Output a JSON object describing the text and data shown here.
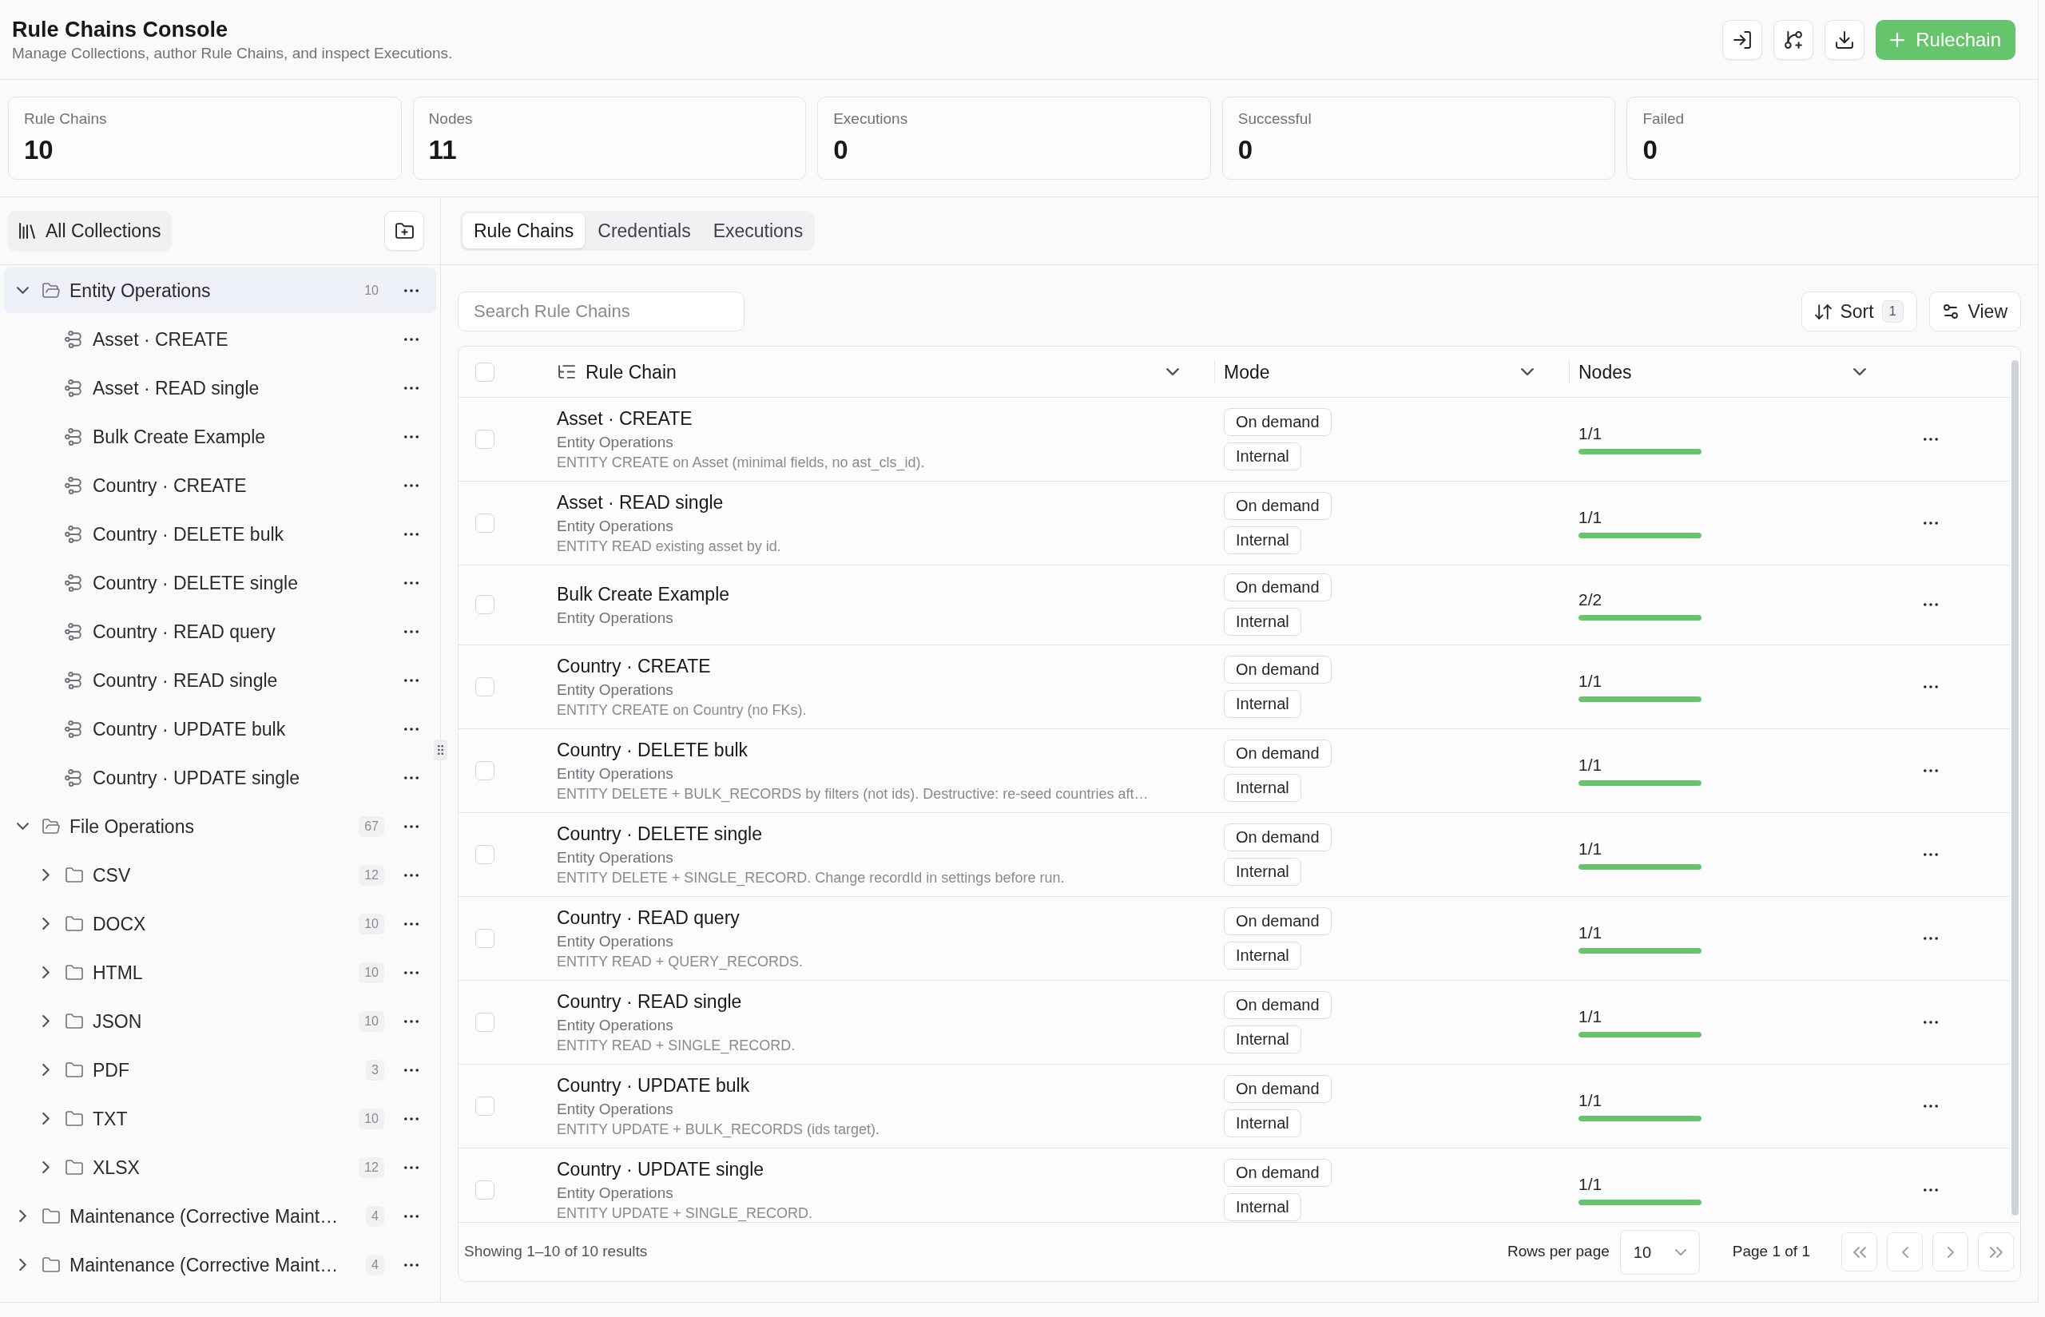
{
  "header": {
    "title": "Rule Chains Console",
    "subtitle": "Manage Collections, author Rule Chains, and inspect Executions.",
    "primary_button": "Rulechain"
  },
  "stats": [
    {
      "label": "Rule Chains",
      "value": "10"
    },
    {
      "label": "Nodes",
      "value": "11"
    },
    {
      "label": "Executions",
      "value": "0"
    },
    {
      "label": "Successful",
      "value": "0"
    },
    {
      "label": "Failed",
      "value": "0"
    }
  ],
  "sidebar": {
    "all_collections": "All Collections",
    "tree": [
      {
        "kind": "folder",
        "label": "Entity Operations",
        "count": "10",
        "expanded": true,
        "selected": true,
        "children": [
          {
            "kind": "rulechain",
            "label": "Asset · CREATE",
            "selected": false
          },
          {
            "kind": "rulechain",
            "label": "Asset · READ single",
            "selected": false
          },
          {
            "kind": "rulechain",
            "label": "Bulk Create Example",
            "selected": false
          },
          {
            "kind": "rulechain",
            "label": "Country · CREATE",
            "selected": false
          },
          {
            "kind": "rulechain",
            "label": "Country · DELETE bulk",
            "selected": false
          },
          {
            "kind": "rulechain",
            "label": "Country · DELETE single",
            "selected": false
          },
          {
            "kind": "rulechain",
            "label": "Country · READ query",
            "selected": false
          },
          {
            "kind": "rulechain",
            "label": "Country · READ single",
            "selected": false
          },
          {
            "kind": "rulechain",
            "label": "Country · UPDATE bulk",
            "selected": false
          },
          {
            "kind": "rulechain",
            "label": "Country · UPDATE single",
            "selected": false
          }
        ]
      },
      {
        "kind": "folder",
        "label": "File Operations",
        "count": "67",
        "expanded": true,
        "selected": false,
        "children": [
          {
            "kind": "folder",
            "label": "CSV",
            "count": "12",
            "expanded": false,
            "selected": false
          },
          {
            "kind": "folder",
            "label": "DOCX",
            "count": "10",
            "expanded": false,
            "selected": false
          },
          {
            "kind": "folder",
            "label": "HTML",
            "count": "10",
            "expanded": false,
            "selected": false
          },
          {
            "kind": "folder",
            "label": "JSON",
            "count": "10",
            "expanded": false,
            "selected": false
          },
          {
            "kind": "folder",
            "label": "PDF",
            "count": "3",
            "expanded": false,
            "selected": false
          },
          {
            "kind": "folder",
            "label": "TXT",
            "count": "10",
            "expanded": false,
            "selected": false
          },
          {
            "kind": "folder",
            "label": "XLSX",
            "count": "12",
            "expanded": false,
            "selected": false
          }
        ]
      },
      {
        "kind": "folder",
        "label": "Maintenance (Corrective Maint…",
        "count": "4",
        "expanded": false,
        "selected": false
      },
      {
        "kind": "folder",
        "label": "Maintenance (Corrective Maint…",
        "count": "4",
        "expanded": false,
        "selected": false
      }
    ]
  },
  "tabs": [
    {
      "label": "Rule Chains",
      "selected": true
    },
    {
      "label": "Credentials",
      "selected": false
    },
    {
      "label": "Executions",
      "selected": false
    }
  ],
  "toolbar": {
    "search": {
      "placeholder": "Search Rule Chains"
    },
    "sort": {
      "label": "Sort",
      "count": "1"
    },
    "view": {
      "label": "View"
    }
  },
  "table": {
    "select_all": {
      "checked": false
    },
    "columns": [
      {
        "label": "Rule Chain"
      },
      {
        "label": "Mode"
      },
      {
        "label": "Nodes"
      }
    ],
    "rows": [
      {
        "checked": false,
        "name": "Asset · CREATE",
        "collection": "Entity Operations",
        "description": "ENTITY CREATE on Asset (minimal fields, no ast_cls_id).",
        "tags": [
          "On demand",
          "Internal"
        ],
        "nodes": "1/1",
        "level": 1
      },
      {
        "checked": false,
        "name": "Asset · READ single",
        "collection": "Entity Operations",
        "description": "ENTITY READ existing asset by id.",
        "tags": [
          "On demand",
          "Internal"
        ],
        "nodes": "1/1",
        "level": 1
      },
      {
        "checked": false,
        "name": "Bulk Create Example",
        "collection": "Entity Operations",
        "tags": [
          "On demand",
          "Internal"
        ],
        "nodes": "2/2",
        "level": 1
      },
      {
        "checked": false,
        "name": "Country · CREATE",
        "collection": "Entity Operations",
        "description": "ENTITY CREATE on Country (no FKs).",
        "tags": [
          "On demand",
          "Internal"
        ],
        "nodes": "1/1",
        "level": 1
      },
      {
        "checked": false,
        "name": "Country · DELETE bulk",
        "collection": "Entity Operations",
        "description": "ENTITY DELETE + BULK_RECORDS by filters (not ids). Destructive: re-seed countries aft…",
        "tags": [
          "On demand",
          "Internal"
        ],
        "nodes": "1/1",
        "level": 1
      },
      {
        "checked": false,
        "name": "Country · DELETE single",
        "collection": "Entity Operations",
        "description": "ENTITY DELETE + SINGLE_RECORD. Change recordId in settings before run.",
        "tags": [
          "On demand",
          "Internal"
        ],
        "nodes": "1/1",
        "level": 1
      },
      {
        "checked": false,
        "name": "Country · READ query",
        "collection": "Entity Operations",
        "description": "ENTITY READ + QUERY_RECORDS.",
        "tags": [
          "On demand",
          "Internal"
        ],
        "nodes": "1/1",
        "level": 1
      },
      {
        "checked": false,
        "name": "Country · READ single",
        "collection": "Entity Operations",
        "description": "ENTITY READ + SINGLE_RECORD.",
        "tags": [
          "On demand",
          "Internal"
        ],
        "nodes": "1/1",
        "level": 1
      },
      {
        "checked": false,
        "name": "Country · UPDATE bulk",
        "collection": "Entity Operations",
        "description": "ENTITY UPDATE + BULK_RECORDS (ids target).",
        "tags": [
          "On demand",
          "Internal"
        ],
        "nodes": "1/1",
        "level": 1
      },
      {
        "checked": false,
        "name": "Country · UPDATE single",
        "collection": "Entity Operations",
        "description": "ENTITY UPDATE + SINGLE_RECORD.",
        "tags": [
          "On demand",
          "Internal"
        ],
        "nodes": "1/1",
        "level": 1
      }
    ],
    "footer": {
      "summary": "Showing 1–10 of 10 results",
      "rows_per_page_label": "Rows per page",
      "rows_per_page": "10",
      "page": "Page 1 of 1"
    }
  }
}
